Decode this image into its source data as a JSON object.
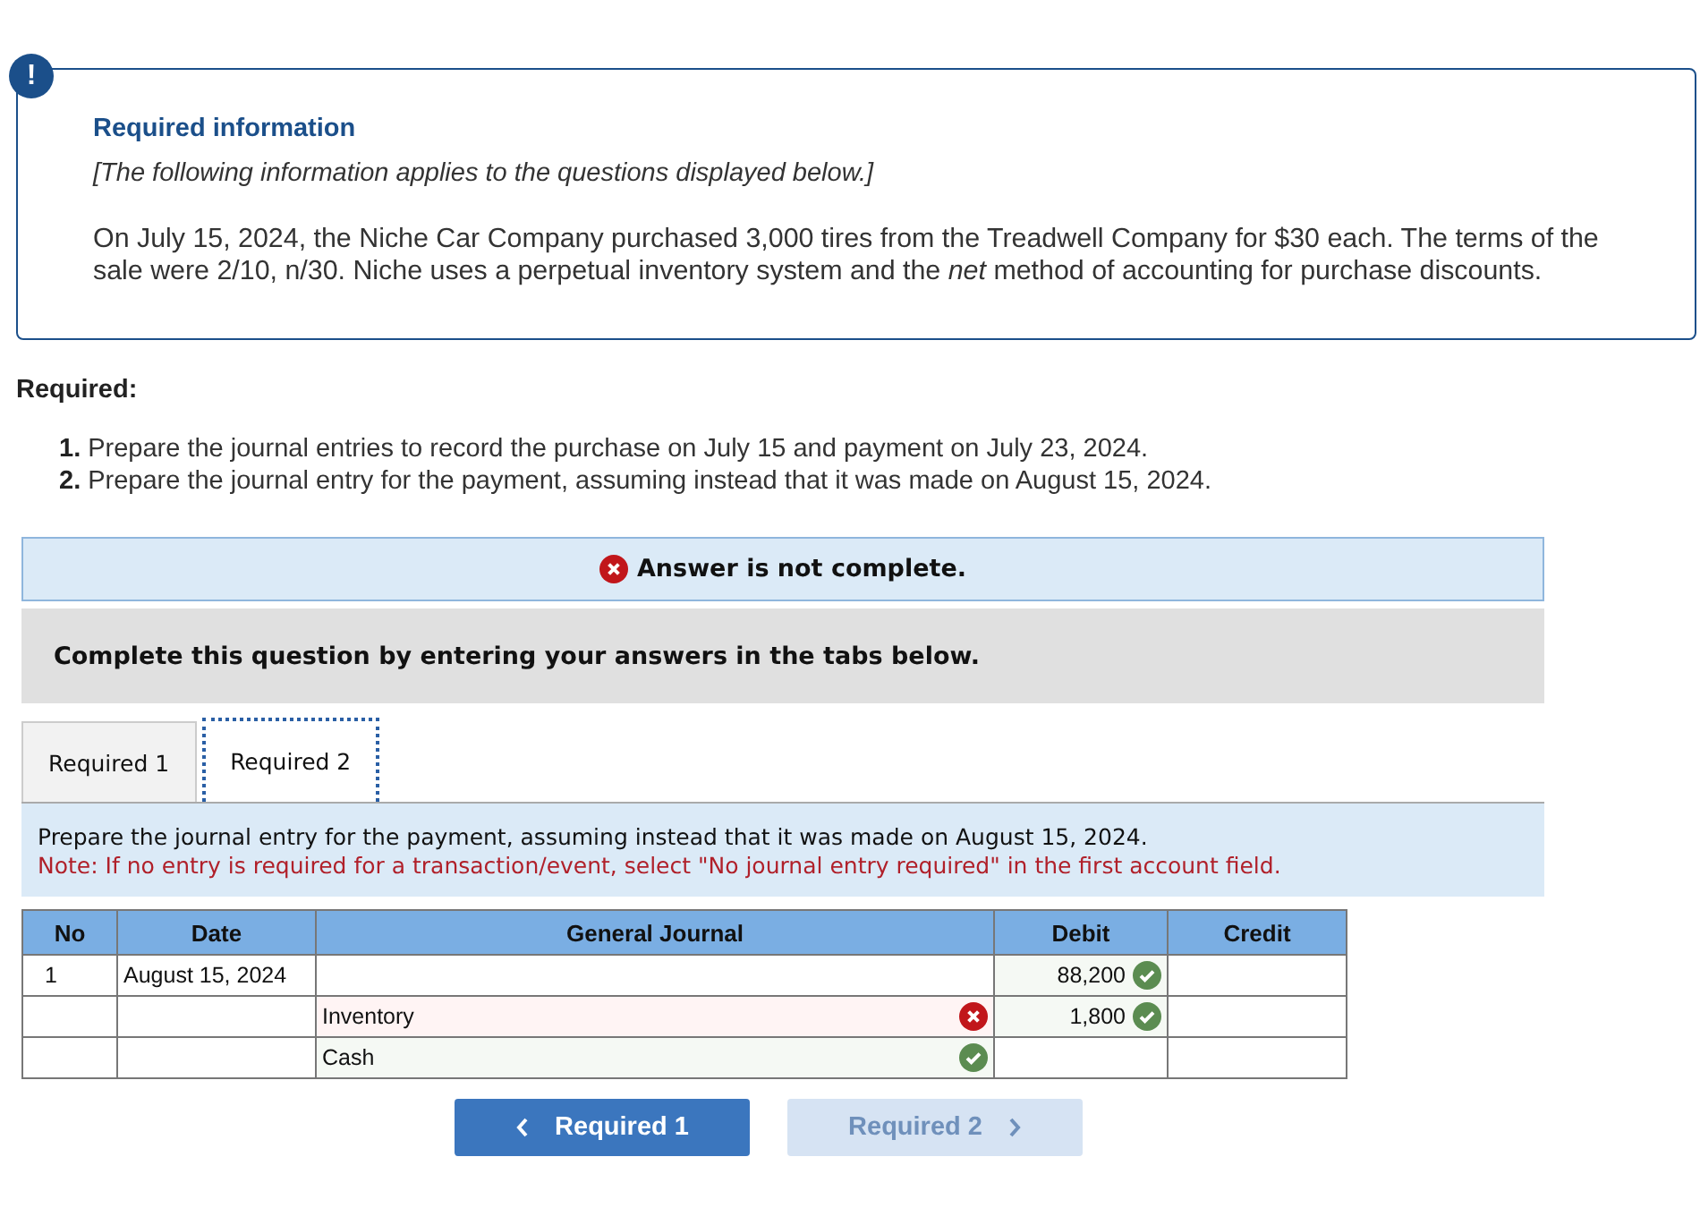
{
  "info": {
    "icon": "!",
    "title": "Required information",
    "note": "[The following information applies to the questions displayed below.]",
    "text": "On July 15, 2024, the Niche Car Company purchased 3,000 tires from the Treadwell Company for $30 each. The terms of the sale were 2/10, n/30. Niche uses a perpetual inventory system and the *net* method of accounting for purchase discounts."
  },
  "required": {
    "heading": "Required:",
    "items": [
      {
        "number": "1.",
        "text": "Prepare the journal entries to record the purchase on July 15 and payment on July 23, 2024."
      },
      {
        "number": "2.",
        "text": "Prepare the journal entry for the payment, assuming instead that it was made on August 15, 2024."
      }
    ]
  },
  "result": {
    "kind": "incomplete",
    "message": "Answer is not complete."
  },
  "instruction": "Complete this question by entering your answers in the tabs below.",
  "tabs": [
    {
      "label": "Required 1",
      "selected": false
    },
    {
      "label": "Required 2",
      "selected": true
    }
  ],
  "prompt": {
    "text": "Prepare the journal entry for the payment, assuming instead that it was made on August 15, 2024.",
    "note": "Note: If no entry is required for a transaction/event, select \"No journal entry required\" in the first account field."
  },
  "table": {
    "columns": [
      "No",
      "Date",
      "General Journal",
      "Debit",
      "Credit"
    ],
    "rows": [
      {
        "no": "1",
        "date": "August 15, 2024",
        "account": {
          "kind": "blank"
        },
        "debit": {
          "text": "88,200",
          "kind": "correct"
        }
      },
      {
        "account": {
          "text": "Inventory",
          "kind": "incorrect"
        },
        "debit": {
          "text": "1,800",
          "kind": "correct"
        }
      },
      {
        "account": {
          "text": "Cash",
          "kind": "correct"
        },
        "debit": {
          "kind": "blank"
        }
      }
    ]
  },
  "buttons": [
    {
      "label": "Required 1",
      "kind": "prev",
      "disabled": false
    },
    {
      "label": "Required 2",
      "kind": "next",
      "disabled": true
    }
  ]
}
